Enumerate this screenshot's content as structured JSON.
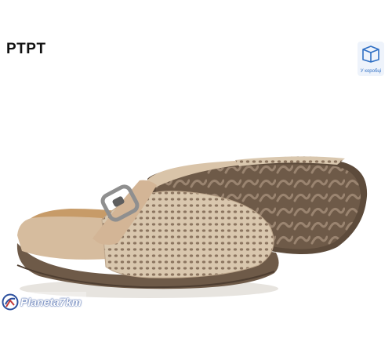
{
  "brand": {
    "label": "PTPT"
  },
  "packaging_badge": {
    "label": "У коробці",
    "icon": "box-icon",
    "color": "#2f6fc4"
  },
  "watermark": {
    "text": "Planeta7km",
    "icon": "planeta-logo-icon",
    "color": "#2b4f9e"
  },
  "product": {
    "colors": {
      "upper": "#d7c2a9",
      "sole": "#6e5a48",
      "insole": "#c79b68"
    }
  }
}
